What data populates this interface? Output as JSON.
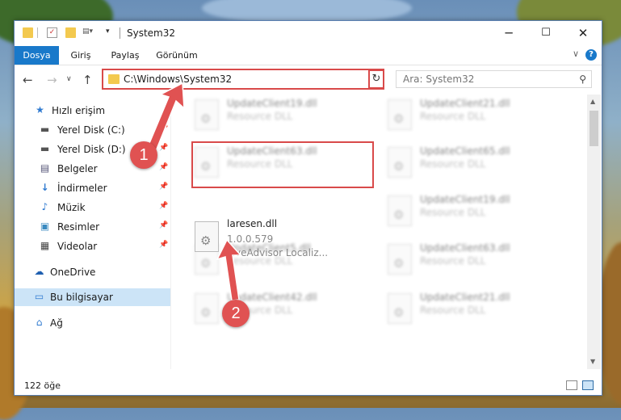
{
  "title_bar": {
    "title": "System32",
    "minimize": "─",
    "maximize": "☐",
    "close": "✕"
  },
  "ribbon": {
    "tabs": [
      "Dosya",
      "Giriş",
      "Paylaş",
      "Görünüm"
    ],
    "help": "?"
  },
  "address_bar": {
    "path": "C:\\Windows\\System32",
    "search_placeholder": "Ara: System32"
  },
  "nav_pane": {
    "items": [
      {
        "label": "Hızlı erişim",
        "icon": "star-icon"
      },
      {
        "label": "Yerel Disk (C:)",
        "icon": "drive-icon"
      },
      {
        "label": "Yerel Disk (D:)",
        "icon": "drive-icon"
      },
      {
        "label": "Belgeler",
        "icon": "document-icon"
      },
      {
        "label": "İndirmeler",
        "icon": "download-icon"
      },
      {
        "label": "Müzik",
        "icon": "music-icon"
      },
      {
        "label": "Resimler",
        "icon": "pictures-icon"
      },
      {
        "label": "Videolar",
        "icon": "video-icon"
      },
      {
        "label": "OneDrive",
        "icon": "cloud-icon"
      },
      {
        "label": "Bu bilgisayar",
        "icon": "computer-icon"
      },
      {
        "label": "Ağ",
        "icon": "network-icon"
      }
    ],
    "selected": "Bu bilgisayar"
  },
  "files": {
    "left_column": [
      {
        "name": "UpdateClient19.dll",
        "sub": "Resource DLL"
      },
      {
        "name": "UpdateClient63.dll",
        "sub": "Resource DLL"
      },
      {
        "name": "UpdateClient5.dll",
        "sub": "Resource DLL"
      },
      {
        "name": "UpdateClient42.dll",
        "sub": "Resource DLL"
      }
    ],
    "right_column": [
      {
        "name": "UpdateClient21.dll",
        "sub": "Resource DLL"
      },
      {
        "name": "UpdateClient65.dll",
        "sub": "Resource DLL"
      },
      {
        "name": "UpdateClient19.dll",
        "sub": "Resource DLL"
      },
      {
        "name": "UpdateClient63.dll",
        "sub": "Resource DLL"
      },
      {
        "name": "UpdateClient21.dll",
        "sub": "Resource DLL"
      }
    ],
    "highlighted": {
      "name": "laresen.dll",
      "version": "1.0.0.579",
      "description": "LiveAdvisor Localiz..."
    }
  },
  "status_bar": {
    "count": "122 öğe"
  },
  "callouts": {
    "step1": "1",
    "step2": "2",
    "color": "#e05252"
  }
}
